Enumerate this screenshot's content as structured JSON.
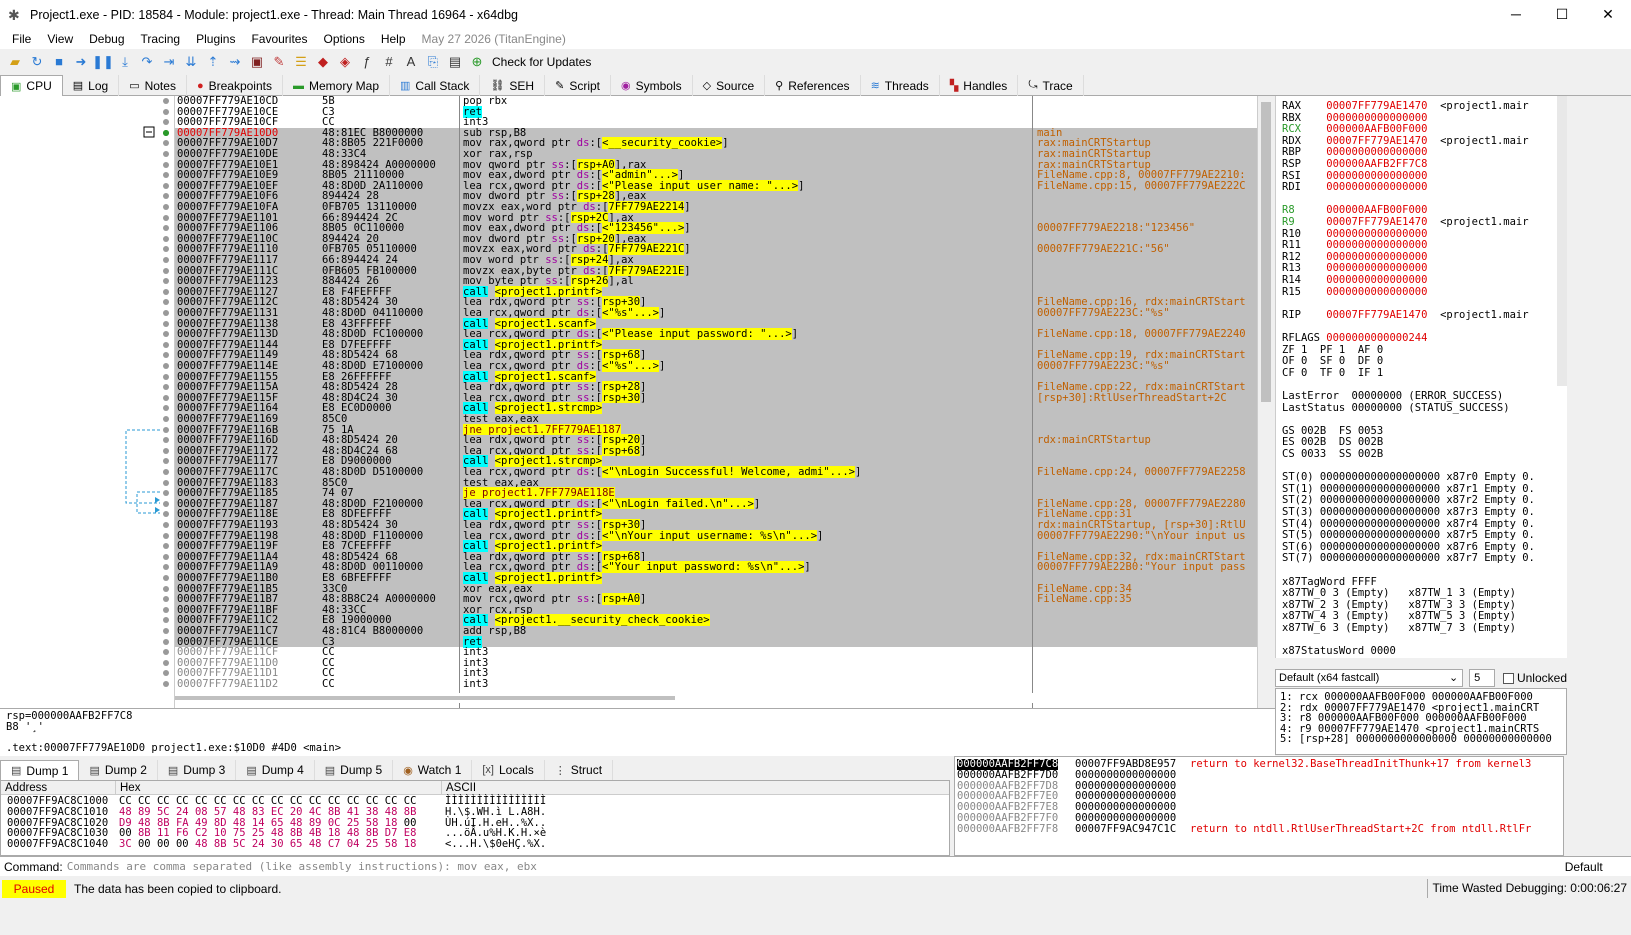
{
  "window": {
    "title": "Project1.exe - PID: 18584 - Module: project1.exe - Thread: Main Thread 16964 - x64dbg"
  },
  "menu": {
    "items": [
      "File",
      "View",
      "Debug",
      "Tracing",
      "Plugins",
      "Favourites",
      "Options",
      "Help"
    ],
    "date": "May 27 2026 (TitanEngine)"
  },
  "toolbar": {
    "check_updates": "Check for Updates"
  },
  "tabs": [
    "CPU",
    "Log",
    "Notes",
    "Breakpoints",
    "Memory Map",
    "Call Stack",
    "SEH",
    "Script",
    "Symbols",
    "Source",
    "References",
    "Threads",
    "Handles",
    "Trace"
  ],
  "disasm": [
    {
      "a": "00007FF779AE10CD",
      "b": "5B",
      "i": "pop rbx",
      "c": "",
      "s": "n"
    },
    {
      "a": "00007FF779AE10CE",
      "b": "C3",
      "i": "ret",
      "c": "",
      "s": "n"
    },
    {
      "a": "00007FF779AE10CF",
      "b": "CC",
      "i": "int3",
      "c": "",
      "s": "n"
    },
    {
      "a": "00007FF779AE10D0",
      "b": "48:81EC B8000000",
      "i": "sub rsp,B8",
      "c": "main",
      "s": "r"
    },
    {
      "a": "00007FF779AE10D7",
      "b": "48:8B05 221F0000",
      "i": "mov rax,qword ptr ds:[<__security_cookie>]",
      "c": "rax:mainCRTStartup",
      "s": "s"
    },
    {
      "a": "00007FF779AE10DE",
      "b": "48:33C4",
      "i": "xor rax,rsp",
      "c": "rax:mainCRTStartup",
      "s": "s"
    },
    {
      "a": "00007FF779AE10E1",
      "b": "48:898424 A0000000",
      "i": "mov qword ptr ss:[rsp+A0],rax",
      "c": "rax:mainCRTStartup",
      "s": "s"
    },
    {
      "a": "00007FF779AE10E9",
      "b": "8B05 21110000",
      "i": "mov eax,dword ptr ds:[<\"admin\"...>]",
      "c": "FileName.cpp:8, 00007FF779AE2210:",
      "s": "s"
    },
    {
      "a": "00007FF779AE10EF",
      "b": "48:8D0D 2A110000",
      "i": "lea rcx,qword ptr ds:[<\"Please input user name: \"...>]",
      "c": "FileName.cpp:15, 00007FF779AE222C",
      "s": "s"
    },
    {
      "a": "00007FF779AE10F6",
      "b": "894424 28",
      "i": "mov dword ptr ss:[rsp+28],eax",
      "c": "",
      "s": "s"
    },
    {
      "a": "00007FF779AE10FA",
      "b": "0FB705 13110000",
      "i": "movzx eax,word ptr ds:[7FF779AE2214]",
      "c": "",
      "s": "s"
    },
    {
      "a": "00007FF779AE1101",
      "b": "66:894424 2C",
      "i": "mov word ptr ss:[rsp+2C],ax",
      "c": "",
      "s": "s"
    },
    {
      "a": "00007FF779AE1106",
      "b": "8B05 0C110000",
      "i": "mov eax,dword ptr ds:[<\"123456\"...>]",
      "c": "00007FF779AE2218:\"123456\"",
      "s": "s"
    },
    {
      "a": "00007FF779AE110C",
      "b": "894424 20",
      "i": "mov dword ptr ss:[rsp+20],eax",
      "c": "",
      "s": "s"
    },
    {
      "a": "00007FF779AE1110",
      "b": "0FB705 05110000",
      "i": "movzx eax,word ptr ds:[7FF779AE221C]",
      "c": "00007FF779AE221C:\"56\"",
      "s": "s"
    },
    {
      "a": "00007FF779AE1117",
      "b": "66:894424 24",
      "i": "mov word ptr ss:[rsp+24],ax",
      "c": "",
      "s": "s"
    },
    {
      "a": "00007FF779AE111C",
      "b": "0FB605 FB100000",
      "i": "movzx eax,byte ptr ds:[7FF779AE221E]",
      "c": "",
      "s": "s"
    },
    {
      "a": "00007FF779AE1123",
      "b": "884424 26",
      "i": "mov byte ptr ss:[rsp+26],al",
      "c": "",
      "s": "s"
    },
    {
      "a": "00007FF779AE1127",
      "b": "E8 F4FEFFFF",
      "i": "call <project1.printf>",
      "c": "",
      "s": "s"
    },
    {
      "a": "00007FF779AE112C",
      "b": "48:8D5424 30",
      "i": "lea rdx,qword ptr ss:[rsp+30]",
      "c": "FileName.cpp:16, rdx:mainCRTStart",
      "s": "s"
    },
    {
      "a": "00007FF779AE1131",
      "b": "48:8D0D 04110000",
      "i": "lea rcx,qword ptr ds:[<\"%s\"...>]",
      "c": "00007FF779AE223C:\"%s\"",
      "s": "s"
    },
    {
      "a": "00007FF779AE1138",
      "b": "E8 43FFFFFF",
      "i": "call <project1.scanf>",
      "c": "",
      "s": "s"
    },
    {
      "a": "00007FF779AE113D",
      "b": "48:8D0D FC100000",
      "i": "lea rcx,qword ptr ds:[<\"Please input password: \"...>]",
      "c": "FileName.cpp:18, 00007FF779AE2240",
      "s": "s"
    },
    {
      "a": "00007FF779AE1144",
      "b": "E8 D7FEFFFF",
      "i": "call <project1.printf>",
      "c": "",
      "s": "s"
    },
    {
      "a": "00007FF779AE1149",
      "b": "48:8D5424 68",
      "i": "lea rdx,qword ptr ss:[rsp+68]",
      "c": "FileName.cpp:19, rdx:mainCRTStart",
      "s": "s"
    },
    {
      "a": "00007FF779AE114E",
      "b": "48:8D0D E7100000",
      "i": "lea rcx,qword ptr ds:[<\"%s\"...>]",
      "c": "00007FF779AE223C:\"%s\"",
      "s": "s"
    },
    {
      "a": "00007FF779AE1155",
      "b": "E8 26FFFFFF",
      "i": "call <project1.scanf>",
      "c": "",
      "s": "s"
    },
    {
      "a": "00007FF779AE115A",
      "b": "48:8D5424 28",
      "i": "lea rdx,qword ptr ss:[rsp+28]",
      "c": "FileName.cpp:22, rdx:mainCRTStart",
      "s": "s"
    },
    {
      "a": "00007FF779AE115F",
      "b": "48:8D4C24 30",
      "i": "lea rcx,qword ptr ss:[rsp+30]",
      "c": "[rsp+30]:RtlUserThreadStart+2C",
      "s": "s"
    },
    {
      "a": "00007FF779AE1164",
      "b": "E8 EC0D0000",
      "i": "call <project1.strcmp>",
      "c": "",
      "s": "s"
    },
    {
      "a": "00007FF779AE1169",
      "b": "85C0",
      "i": "test eax,eax",
      "c": "",
      "s": "s"
    },
    {
      "a": "00007FF779AE116B",
      "b": "75 1A",
      "i": "jne project1.7FF779AE1187",
      "c": "",
      "s": "s"
    },
    {
      "a": "00007FF779AE116D",
      "b": "48:8D5424 20",
      "i": "lea rdx,qword ptr ss:[rsp+20]",
      "c": "rdx:mainCRTStartup",
      "s": "s"
    },
    {
      "a": "00007FF779AE1172",
      "b": "48:8D4C24 68",
      "i": "lea rcx,qword ptr ss:[rsp+68]",
      "c": "",
      "s": "s"
    },
    {
      "a": "00007FF779AE1177",
      "b": "E8 D9000000",
      "i": "call <project1.strcmp>",
      "c": "",
      "s": "s"
    },
    {
      "a": "00007FF779AE117C",
      "b": "48:8D0D D5100000",
      "i": "lea rcx,qword ptr ds:[<\"\\nLogin Successful! Welcome, admi\"...>]",
      "c": "FileName.cpp:24, 00007FF779AE2258",
      "s": "s"
    },
    {
      "a": "00007FF779AE1183",
      "b": "85C0",
      "i": "test eax,eax",
      "c": "",
      "s": "s"
    },
    {
      "a": "00007FF779AE1185",
      "b": "74 07",
      "i": "je project1.7FF779AE118E",
      "c": "",
      "s": "s"
    },
    {
      "a": "00007FF779AE1187",
      "b": "48:8D0D F2100000",
      "i": "lea rcx,qword ptr ds:[<\"\\nLogin failed.\\n\"...>]",
      "c": "FileName.cpp:28, 00007FF779AE2280",
      "s": "s"
    },
    {
      "a": "00007FF779AE118E",
      "b": "E8 8DFEFFFF",
      "i": "call <project1.printf>",
      "c": "FileName.cpp:31",
      "s": "s"
    },
    {
      "a": "00007FF779AE1193",
      "b": "48:8D5424 30",
      "i": "lea rdx,qword ptr ss:[rsp+30]",
      "c": "rdx:mainCRTStartup, [rsp+30]:RtlU",
      "s": "s"
    },
    {
      "a": "00007FF779AE1198",
      "b": "48:8D0D F1100000",
      "i": "lea rcx,qword ptr ds:[<\"\\nYour input username: %s\\n\"...>]",
      "c": "00007FF779AE2290:\"\\nYour input us",
      "s": "s"
    },
    {
      "a": "00007FF779AE119F",
      "b": "E8 7CFEFFFF",
      "i": "call <project1.printf>",
      "c": "",
      "s": "s"
    },
    {
      "a": "00007FF779AE11A4",
      "b": "48:8D5424 68",
      "i": "lea rdx,qword ptr ss:[rsp+68]",
      "c": "FileName.cpp:32, rdx:mainCRTStart",
      "s": "s"
    },
    {
      "a": "00007FF779AE11A9",
      "b": "48:8D0D 00110000",
      "i": "lea rcx,qword ptr ds:[<\"Your input password: %s\\n\"...>]",
      "c": "00007FF779AE22B0:\"Your input pass",
      "s": "s"
    },
    {
      "a": "00007FF779AE11B0",
      "b": "E8 6BFEFFFF",
      "i": "call <project1.printf>",
      "c": "",
      "s": "s"
    },
    {
      "a": "00007FF779AE11B5",
      "b": "33C0",
      "i": "xor eax,eax",
      "c": "FileName.cpp:34",
      "s": "s"
    },
    {
      "a": "00007FF779AE11B7",
      "b": "48:8B8C24 A0000000",
      "i": "mov rcx,qword ptr ss:[rsp+A0]",
      "c": "FileName.cpp:35",
      "s": "s"
    },
    {
      "a": "00007FF779AE11BF",
      "b": "48:33CC",
      "i": "xor rcx,rsp",
      "c": "",
      "s": "s"
    },
    {
      "a": "00007FF779AE11C2",
      "b": "E8 19000000",
      "i": "call <project1.__security_check_cookie>",
      "c": "",
      "s": "s"
    },
    {
      "a": "00007FF779AE11C7",
      "b": "48:81C4 B8000000",
      "i": "add rsp,B8",
      "c": "",
      "s": "s"
    },
    {
      "a": "00007FF779AE11CE",
      "b": "C3",
      "i": "ret",
      "c": "",
      "s": "s"
    },
    {
      "a": "00007FF779AE11CF",
      "b": "CC",
      "i": "int3",
      "c": "",
      "s": "d"
    },
    {
      "a": "00007FF779AE11D0",
      "b": "CC",
      "i": "int3",
      "c": "",
      "s": "d"
    },
    {
      "a": "00007FF779AE11D1",
      "b": "CC",
      "i": "int3",
      "c": "",
      "s": "d"
    },
    {
      "a": "00007FF779AE11D2",
      "b": "CC",
      "i": "int3",
      "c": "",
      "s": "d"
    }
  ],
  "registers": [
    {
      "n": "RAX",
      "v": "00007FF779AE1470",
      "x": "<project1.mair"
    },
    {
      "n": "RBX",
      "v": "0000000000000000",
      "x": ""
    },
    {
      "n": "RCX",
      "v": "000000AAFB00F000",
      "x": ""
    },
    {
      "n": "RDX",
      "v": "00007FF779AE1470",
      "x": "<project1.mair"
    },
    {
      "n": "RBP",
      "v": "0000000000000000",
      "x": ""
    },
    {
      "n": "RSP",
      "v": "000000AAFB2FF7C8",
      "x": ""
    },
    {
      "n": "RSI",
      "v": "0000000000000000",
      "x": ""
    },
    {
      "n": "RDI",
      "v": "0000000000000000",
      "x": ""
    },
    {
      "n": "R8",
      "v": "000000AAFB00F000",
      "x": ""
    },
    {
      "n": "R9",
      "v": "00007FF779AE1470",
      "x": "<project1.mair"
    },
    {
      "n": "R10",
      "v": "0000000000000000",
      "x": ""
    },
    {
      "n": "R11",
      "v": "0000000000000000",
      "x": ""
    },
    {
      "n": "R12",
      "v": "0000000000000000",
      "x": ""
    },
    {
      "n": "R13",
      "v": "0000000000000000",
      "x": ""
    },
    {
      "n": "R14",
      "v": "0000000000000000",
      "x": ""
    },
    {
      "n": "R15",
      "v": "0000000000000000",
      "x": ""
    },
    {
      "n": "RIP",
      "v": "00007FF779AE1470",
      "x": "<project1.mair"
    },
    {
      "n": "RFLAGS",
      "v": "0000000000000244",
      "x": ""
    }
  ],
  "flags": [
    "ZF 1  PF 1  AF 0",
    "OF 0  SF 0  DF 0",
    "CF 0  TF 0  IF 1"
  ],
  "errors": [
    "LastError  00000000 (ERROR_SUCCESS)",
    "LastStatus 00000000 (STATUS_SUCCESS)"
  ],
  "segs": [
    "GS 002B  FS 0053",
    "ES 002B  DS 002B",
    "CS 0033  SS 002B"
  ],
  "fpu": [
    "ST(0) 0000000000000000000 x87r0 Empty 0.",
    "ST(1) 0000000000000000000 x87r1 Empty 0.",
    "ST(2) 0000000000000000000 x87r2 Empty 0.",
    "ST(3) 0000000000000000000 x87r3 Empty 0.",
    "ST(4) 0000000000000000000 x87r4 Empty 0.",
    "ST(5) 0000000000000000000 x87r5 Empty 0.",
    "ST(6) 0000000000000000000 x87r6 Empty 0.",
    "ST(7) 0000000000000000000 x87r7 Empty 0."
  ],
  "tagword": [
    "x87TagWord FFFF",
    "x87TW_0 3 (Empty)   x87TW_1 3 (Empty)",
    "x87TW_2 3 (Empty)   x87TW_3 3 (Empty)",
    "x87TW_4 3 (Empty)   x87TW_5 3 (Empty)",
    "x87TW_6 3 (Empty)   x87TW_7 3 (Empty)",
    "",
    "x87StatusWord 0000"
  ],
  "callconv": {
    "label": "Default (x64 fastcall)",
    "count": "5",
    "unlocked": "Unlocked"
  },
  "args": [
    "1: rcx 000000AAFB00F000 000000AAFB00F000",
    "2: rdx 00007FF779AE1470 <project1.mainCRT",
    "3: r8 000000AAFB00F000 000000AAFB00F000",
    "4: r9 00007FF779AE1470 <project1.mainCRTS",
    "5: [rsp+28] 0000000000000000 00000000000000"
  ],
  "info": [
    "rsp=000000AAFB2FF7C8",
    "B8 '¸'",
    "",
    ".text:00007FF779AE10D0 project1.exe:$10D0 #4D0 <main>"
  ],
  "dumptabs": [
    "Dump 1",
    "Dump 2",
    "Dump 3",
    "Dump 4",
    "Dump 5",
    "Watch 1",
    "Locals",
    "Struct"
  ],
  "dump": {
    "h_addr": "Address",
    "h_hex": "Hex",
    "h_ascii": "ASCII",
    "rows": [
      {
        "a": "00007FF9AC8C1000",
        "x": "CC CC CC CC CC CC CC CC CC CC CC CC CC CC CC CC",
        "s": "ÌÌÌÌÌÌÌÌÌÌÌÌÌÌÌÌ"
      },
      {
        "a": "00007FF9AC8C1010",
        "x": "48 89 5C 24 08 57 48 83 EC 20 4C 8B 41 38 48 8B",
        "s": "H.\\$.WH.ì L.A8H."
      },
      {
        "a": "00007FF9AC8C1020",
        "x": "D9 48 8B FA 49 8D 48 14 65 48 89 0C 25 58 18 00",
        "s": "ÙH.úI.H.eH..%X.."
      },
      {
        "a": "00007FF9AC8C1030",
        "x": "00 8B 11 F6 C2 10 75 25 48 8B 4B 18 48 8B D7 E8",
        "s": "...öÂ.u%H.K.H.×è"
      },
      {
        "a": "00007FF9AC8C1040",
        "x": "3C 00 00 00 48 8B 5C 24 30 65 48 C7 04 25 58 18",
        "s": "<...H.\\$0eHÇ.%X."
      }
    ]
  },
  "stack": [
    {
      "a": "000000AAFB2FF7C8",
      "v": "00007FF9ABD8E957",
      "c": "return to kernel32.BaseThreadInitThunk+17 from kernel3",
      "t": "top"
    },
    {
      "a": "000000AAFB2FF7D0",
      "v": "0000000000000000",
      "c": "",
      "t": "n"
    },
    {
      "a": "000000AAFB2FF7D8",
      "v": "0000000000000000",
      "c": "",
      "t": "d"
    },
    {
      "a": "000000AAFB2FF7E0",
      "v": "0000000000000000",
      "c": "",
      "t": "d"
    },
    {
      "a": "000000AAFB2FF7E8",
      "v": "0000000000000000",
      "c": "",
      "t": "d"
    },
    {
      "a": "000000AAFB2FF7F0",
      "v": "0000000000000000",
      "c": "",
      "t": "d"
    },
    {
      "a": "000000AAFB2FF7F8",
      "v": "00007FF9AC947C1C",
      "c": "return to ntdll.RtlUserThreadStart+2C from ntdll.RtlFr",
      "t": "d"
    }
  ],
  "command": {
    "label": "Command:",
    "placeholder": "Commands are comma separated (like assembly instructions): mov eax, ebx",
    "mode": "Default"
  },
  "status": {
    "state": "Paused",
    "message": "The data has been copied to clipboard.",
    "time": "Time Wasted Debugging: 0:00:06:27"
  }
}
